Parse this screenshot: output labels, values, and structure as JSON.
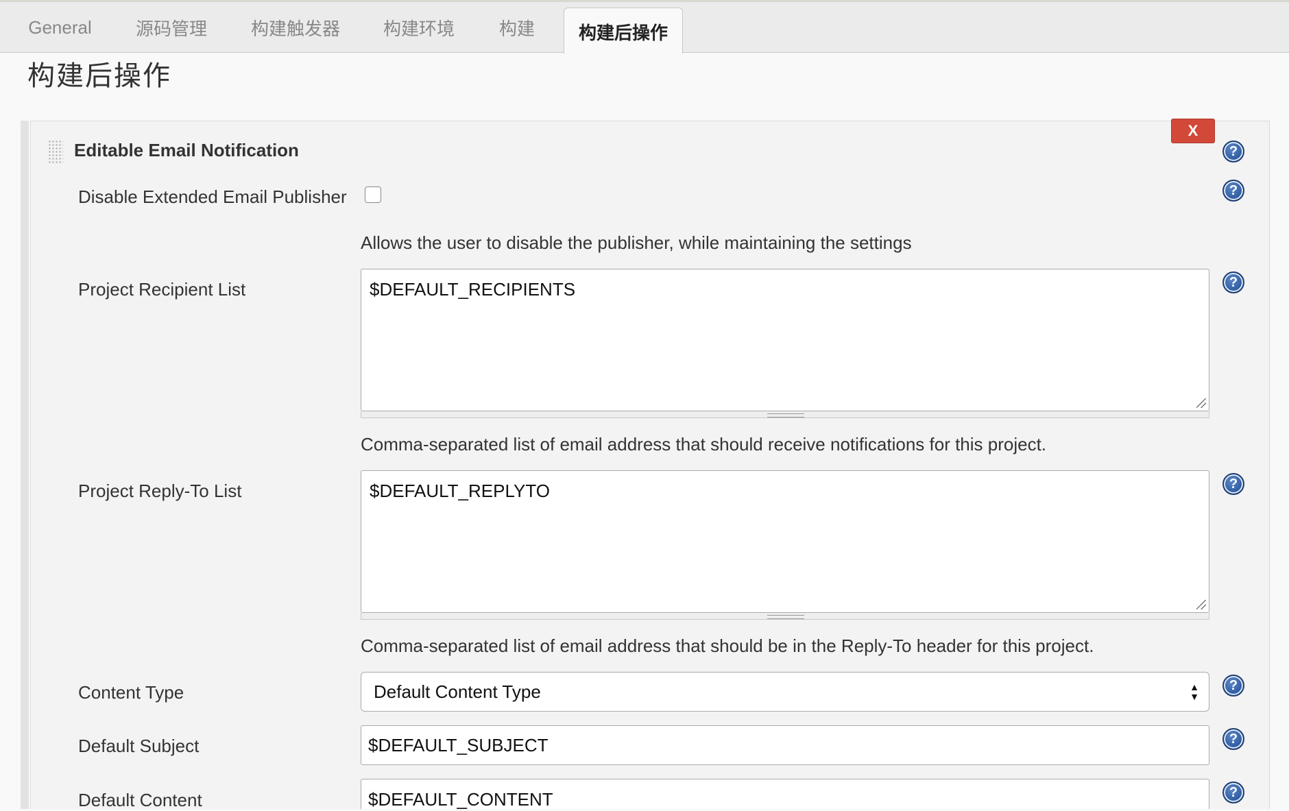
{
  "tabs": [
    {
      "label": "General"
    },
    {
      "label": "源码管理"
    },
    {
      "label": "构建触发器"
    },
    {
      "label": "构建环境"
    },
    {
      "label": "构建"
    },
    {
      "label": "构建后操作"
    }
  ],
  "section_title": "构建后操作",
  "panel": {
    "title": "Editable Email Notification",
    "delete_label": "X",
    "help_glyph": "?"
  },
  "fields": {
    "disable_publisher": {
      "label": "Disable Extended Email Publisher",
      "checked": false,
      "description": "Allows the user to disable the publisher, while maintaining the settings"
    },
    "recipient_list": {
      "label": "Project Recipient List",
      "value": "$DEFAULT_RECIPIENTS",
      "description": "Comma-separated list of email address that should receive notifications for this project."
    },
    "reply_to_list": {
      "label": "Project Reply-To List",
      "value": "$DEFAULT_REPLYTO",
      "description": "Comma-separated list of email address that should be in the Reply-To header for this project."
    },
    "content_type": {
      "label": "Content Type",
      "value": "Default Content Type"
    },
    "default_subject": {
      "label": "Default Subject",
      "value": "$DEFAULT_SUBJECT"
    },
    "default_content": {
      "label": "Default Content",
      "value": "$DEFAULT_CONTENT"
    }
  },
  "colors": {
    "delete_button": "#d24939",
    "help_icon": "#2d5aa0",
    "panel_bg": "#f3f3f3",
    "tabbar_bg": "#ebebeb"
  },
  "icons": {
    "help": "help-icon",
    "drag": "drag-handle-icon",
    "select": "select-arrows-icon",
    "resize": "resize-corner-icon"
  }
}
